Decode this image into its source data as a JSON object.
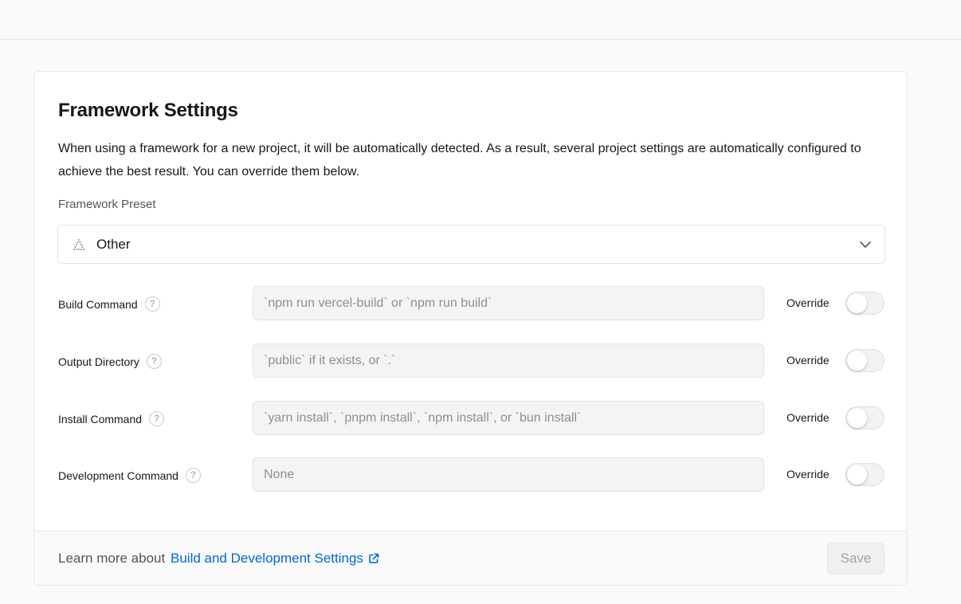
{
  "card": {
    "title": "Framework Settings",
    "description": "When using a framework for a new project, it will be automatically detected. As a result, several project settings are automatically configured to achieve the best result. You can override them below."
  },
  "preset": {
    "label": "Framework Preset",
    "value": "Other",
    "icon": "triangle-dotted-icon"
  },
  "rows": [
    {
      "label": "Build Command",
      "placeholder": "`npm run vercel-build` or `npm run build`",
      "value": "",
      "override_label": "Override",
      "override_on": false
    },
    {
      "label": "Output Directory",
      "placeholder": "`public` if it exists, or `.`",
      "value": "",
      "override_label": "Override",
      "override_on": false
    },
    {
      "label": "Install Command",
      "placeholder": "`yarn install`, `pnpm install`, `npm install`, or `bun install`",
      "value": "",
      "override_label": "Override",
      "override_on": false
    },
    {
      "label": "Development Command",
      "placeholder": "None",
      "value": "",
      "override_label": "Override",
      "override_on": false
    }
  ],
  "footer": {
    "text": "Learn more about",
    "link_text": "Build and Development Settings",
    "save_label": "Save"
  },
  "colors": {
    "link": "#0068d6",
    "background": "#fafafa",
    "card": "#ffffff"
  }
}
